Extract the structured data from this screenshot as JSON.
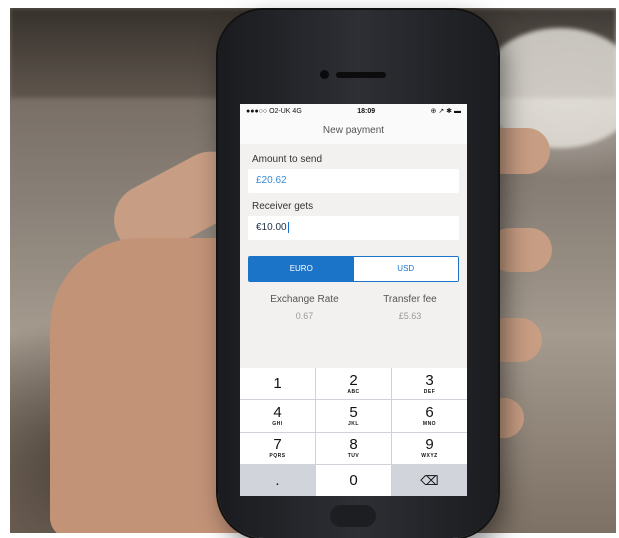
{
  "status_bar": {
    "carrier": "●●●○○ O2-UK 4G",
    "time": "18:09",
    "icons": "⊕ ↗ ✱ ▬"
  },
  "screen": {
    "title": "New payment"
  },
  "form": {
    "amount_label": "Amount to send",
    "amount_value": "£20.62",
    "receiver_label": "Receiver gets",
    "receiver_value": "€10.00"
  },
  "currency_toggle": {
    "options": [
      "EURO",
      "USD"
    ],
    "selected": "EURO"
  },
  "info": {
    "exchange_label": "Exchange Rate",
    "exchange_value": "0.67",
    "fee_label": "Transfer fee",
    "fee_value": "£5.63"
  },
  "keypad": {
    "keys": [
      {
        "num": "1",
        "letters": ""
      },
      {
        "num": "2",
        "letters": "ABC"
      },
      {
        "num": "3",
        "letters": "DEF"
      },
      {
        "num": "4",
        "letters": "GHI"
      },
      {
        "num": "5",
        "letters": "JKL"
      },
      {
        "num": "6",
        "letters": "MNO"
      },
      {
        "num": "7",
        "letters": "PQRS"
      },
      {
        "num": "8",
        "letters": "TUV"
      },
      {
        "num": "9",
        "letters": "WXYZ"
      },
      {
        "num": ".",
        "letters": ""
      },
      {
        "num": "0",
        "letters": ""
      },
      {
        "num": "⌫",
        "letters": ""
      }
    ]
  },
  "colors": {
    "accent": "#1c74c8",
    "amount_text": "#3a8ad4"
  }
}
